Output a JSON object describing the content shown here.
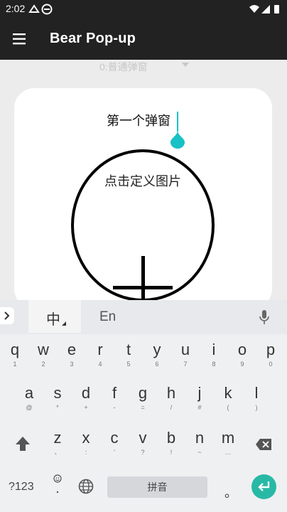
{
  "status_bar": {
    "time": "2:02"
  },
  "app_bar": {
    "title": "Bear Pop-up"
  },
  "spinner": {
    "selected": "0:普通弹窗"
  },
  "dialog": {
    "title_value": "第一个弹窗",
    "image_picker_label": "点击定义图片"
  },
  "keyboard": {
    "toolbar": {
      "lang_cn": "中",
      "lang_en": "En"
    },
    "rows": [
      [
        {
          "k": "q",
          "h": "1"
        },
        {
          "k": "w",
          "h": "2"
        },
        {
          "k": "e",
          "h": "3"
        },
        {
          "k": "r",
          "h": "4"
        },
        {
          "k": "t",
          "h": "5"
        },
        {
          "k": "y",
          "h": "6"
        },
        {
          "k": "u",
          "h": "7"
        },
        {
          "k": "i",
          "h": "8"
        },
        {
          "k": "o",
          "h": "9"
        },
        {
          "k": "p",
          "h": "0"
        }
      ],
      [
        {
          "k": "a",
          "h": "@"
        },
        {
          "k": "s",
          "h": "*"
        },
        {
          "k": "d",
          "h": "+"
        },
        {
          "k": "f",
          "h": "-"
        },
        {
          "k": "g",
          "h": "="
        },
        {
          "k": "h",
          "h": "/"
        },
        {
          "k": "j",
          "h": "#"
        },
        {
          "k": "k",
          "h": "("
        },
        {
          "k": "l",
          "h": ")"
        }
      ],
      [
        {
          "k": "z",
          "h": "、"
        },
        {
          "k": "x",
          "h": ":"
        },
        {
          "k": "c",
          "h": "'"
        },
        {
          "k": "v",
          "h": "?"
        },
        {
          "k": "b",
          "h": "!"
        },
        {
          "k": "n",
          "h": "~"
        },
        {
          "k": "m",
          "h": "…"
        }
      ]
    ],
    "symbols_label": "?123",
    "space_label": "拼音",
    "period_label": "。"
  },
  "colors": {
    "app_bar": "#222222",
    "accent": "#17c1c6",
    "enter": "#27b9a6"
  }
}
